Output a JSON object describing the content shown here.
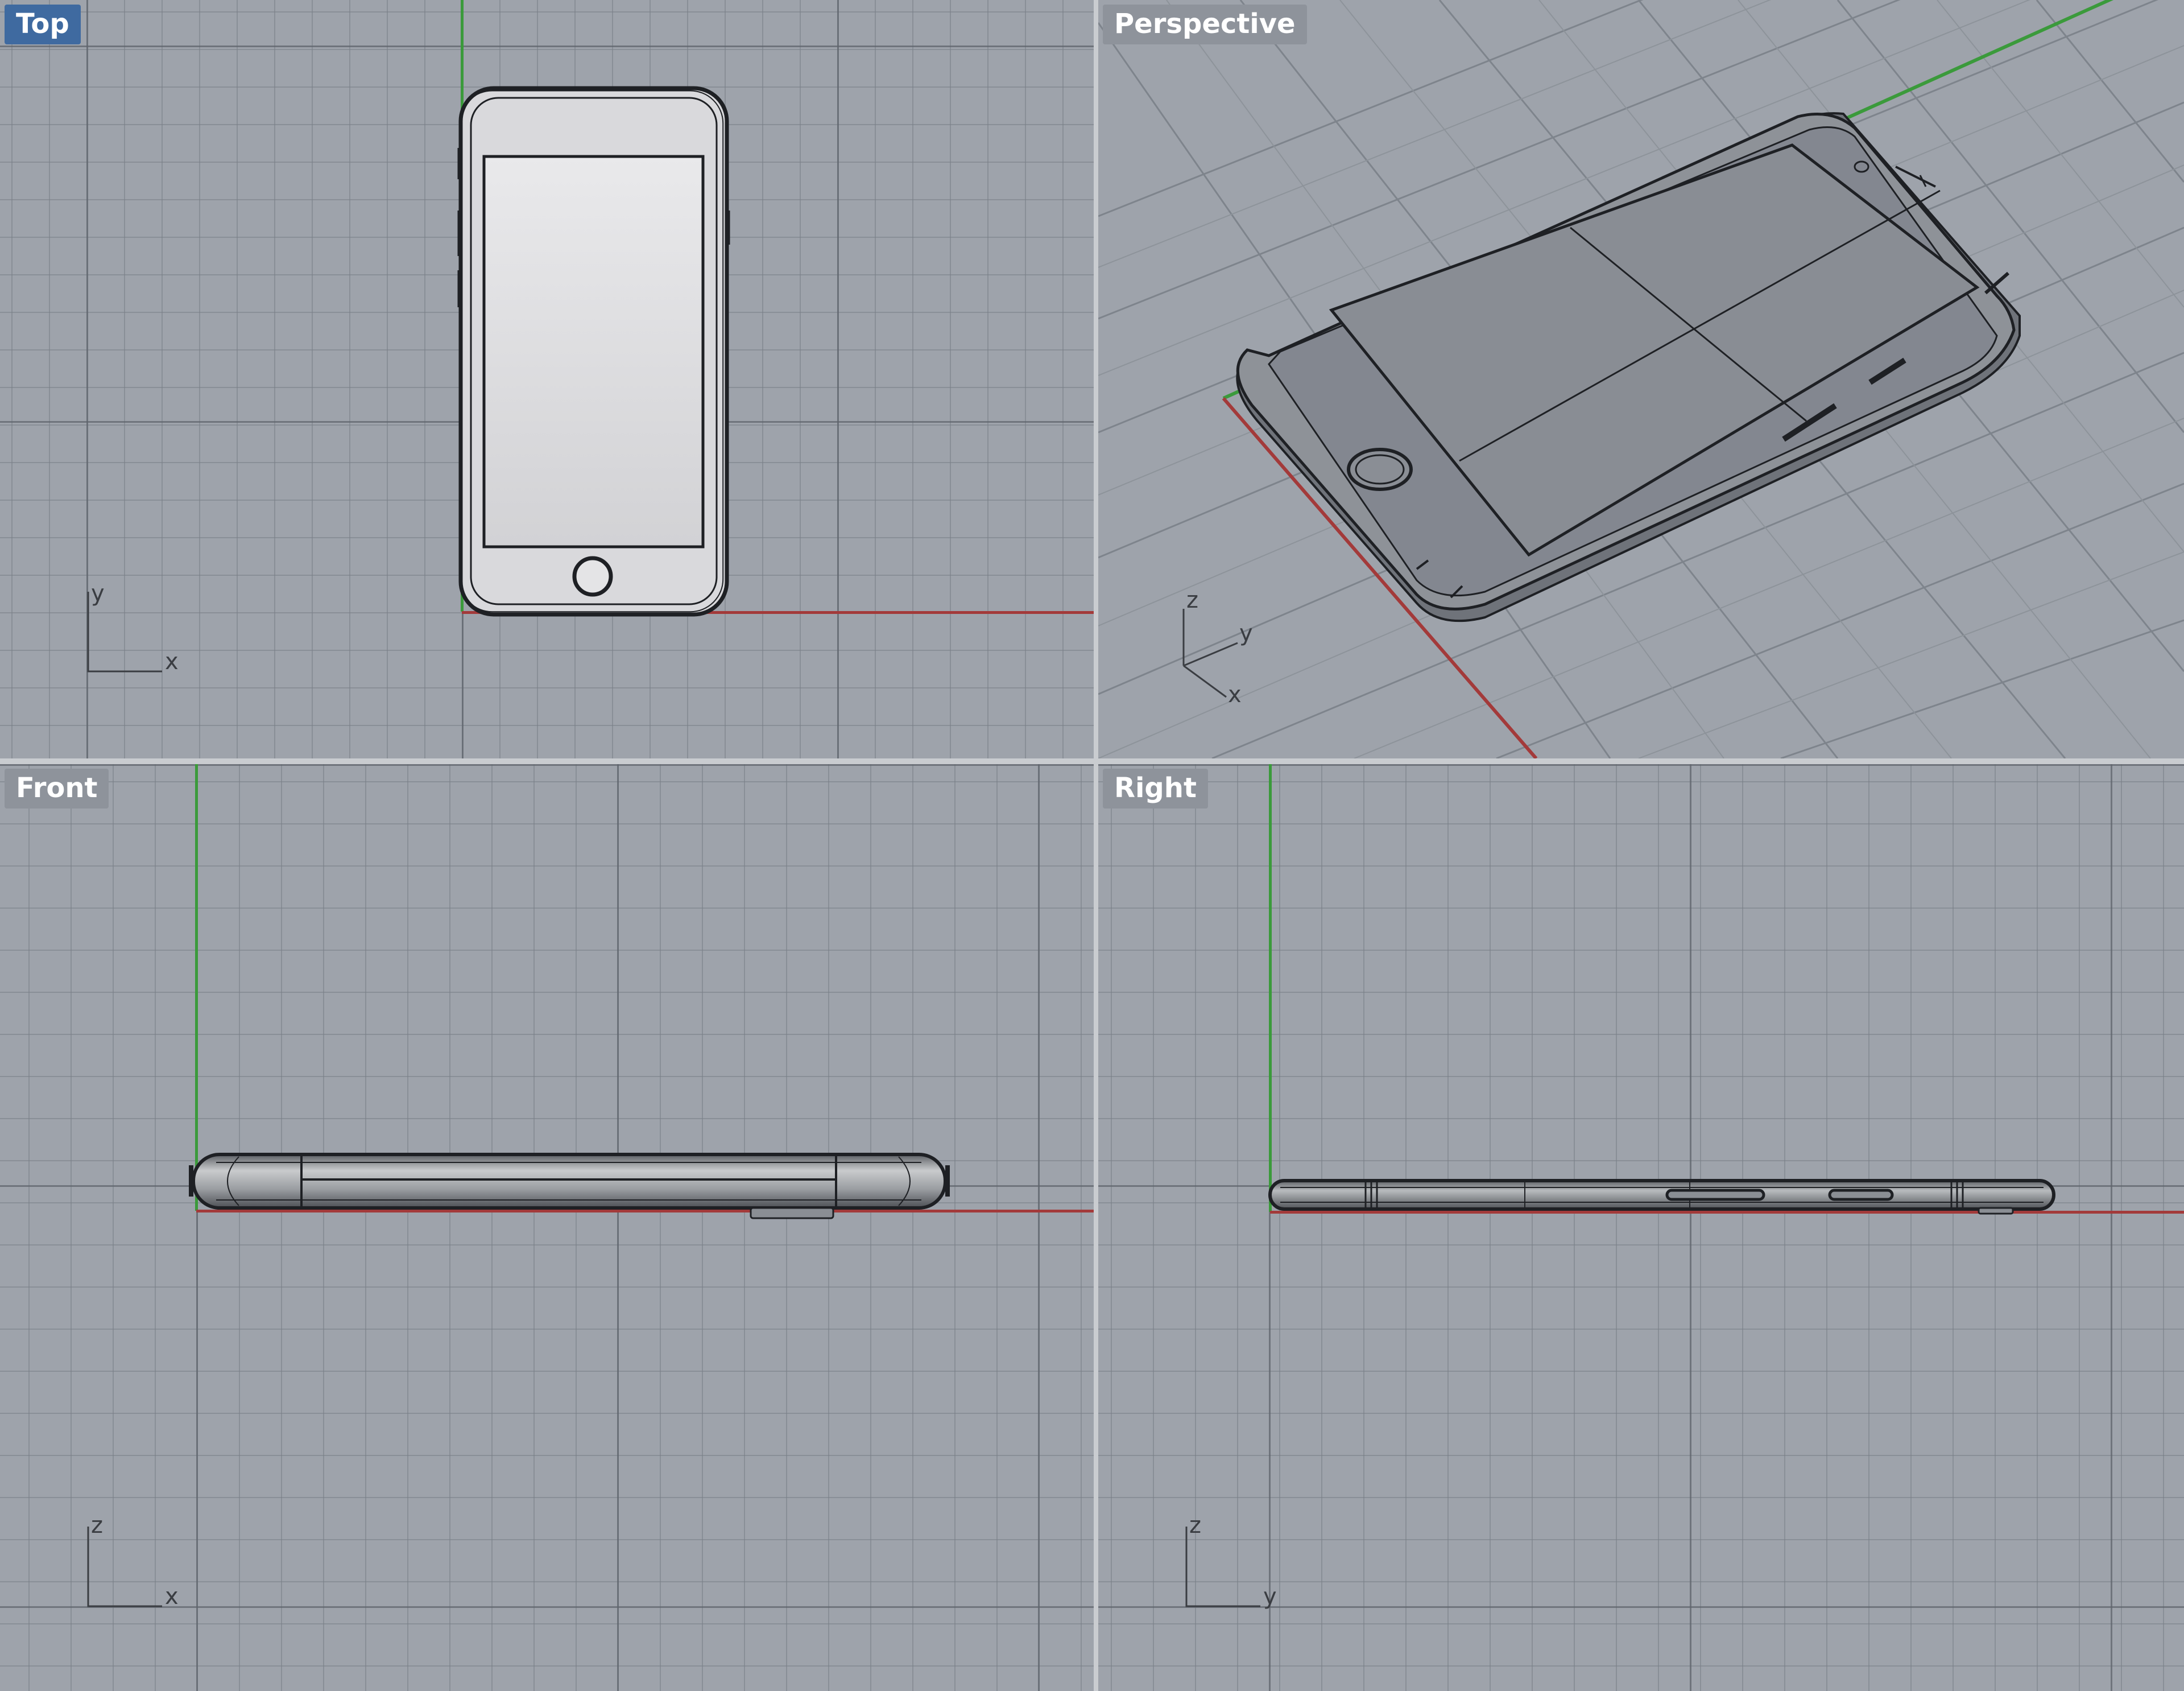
{
  "viewports": {
    "top": {
      "label": "Top",
      "active": true,
      "gizmo": [
        "y",
        "x"
      ]
    },
    "perspective": {
      "label": "Perspective",
      "active": false,
      "gizmo": [
        "z",
        "y",
        "x"
      ]
    },
    "front": {
      "label": "Front",
      "active": false,
      "gizmo": [
        "z",
        "x"
      ]
    },
    "right": {
      "label": "Right",
      "active": false,
      "gizmo": [
        "z",
        "y"
      ]
    }
  },
  "colors": {
    "background": "#9ea3ab",
    "x_axis": "#a33a3a",
    "y_axis": "#3b9a3b",
    "active_label": "#3f6aa0",
    "inactive_label": "#8e939b",
    "wire": "#1e2024"
  },
  "model": "smartphone-wireframe"
}
